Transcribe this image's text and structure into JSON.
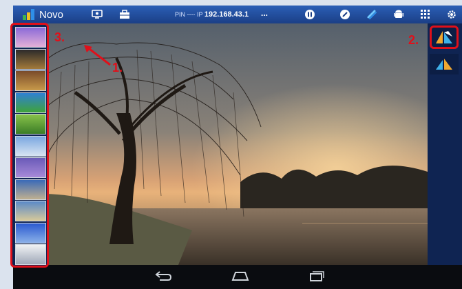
{
  "app": {
    "title": "Novo"
  },
  "topbar": {
    "pin_label": "PIN ----  IP",
    "ip": "192.168.43.1",
    "more": "...",
    "icons": [
      "presenter-icon",
      "toolbox-icon",
      "pause-icon",
      "annotate-icon",
      "link-icon",
      "android-icon",
      "apps-grid-icon",
      "settings-gear-icon"
    ]
  },
  "annotations": {
    "label_1": "1.",
    "label_2": "2.",
    "label_3": "3."
  },
  "thumbnails": [
    {
      "name": "purple-sunset",
      "colors": [
        "#8a6ad8",
        "#e4b0d8"
      ]
    },
    {
      "name": "night-road",
      "colors": [
        "#2b2a2a",
        "#a37a3a"
      ]
    },
    {
      "name": "autumn-tree",
      "colors": [
        "#7a4b2a",
        "#c89a4a"
      ]
    },
    {
      "name": "blue-sky-field",
      "colors": [
        "#2f80d4",
        "#3fa33a"
      ]
    },
    {
      "name": "green-hills",
      "colors": [
        "#88c24a",
        "#3b7d27"
      ]
    },
    {
      "name": "clouds",
      "colors": [
        "#7aa7e0",
        "#d8e4f2"
      ]
    },
    {
      "name": "lavender-field",
      "colors": [
        "#6a5ab8",
        "#a78ad8"
      ]
    },
    {
      "name": "rail-tracks",
      "colors": [
        "#3a6ab8",
        "#c0b090"
      ]
    },
    {
      "name": "coast",
      "colors": [
        "#5a8ac8",
        "#d7c99a"
      ]
    },
    {
      "name": "blue-lake",
      "colors": [
        "#2a5ad0",
        "#8ab0e8"
      ]
    },
    {
      "name": "white-clouds",
      "colors": [
        "#f0f2f4",
        "#9fa8b8"
      ]
    }
  ],
  "colors": {
    "accent_red": "#e0101a",
    "panel_navy": "#0f2452"
  }
}
